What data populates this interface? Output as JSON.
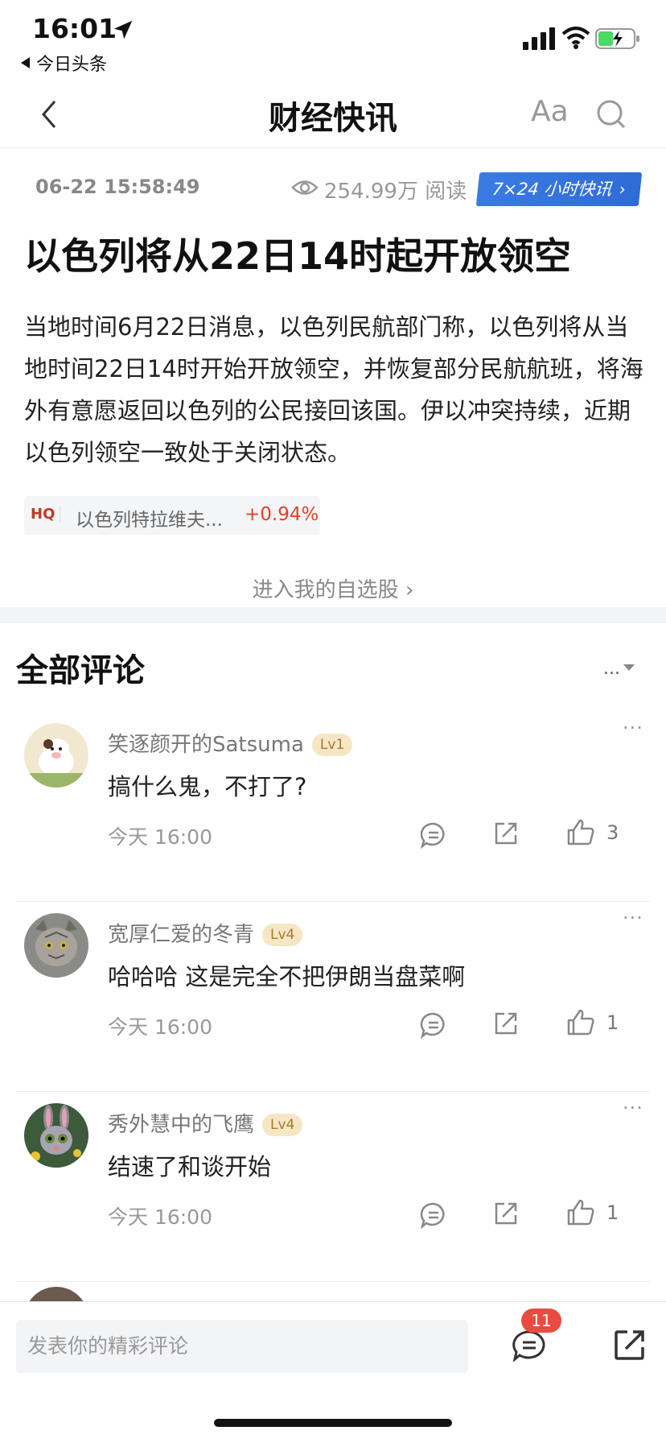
{
  "status_bar": {
    "time": "16:01",
    "back_app_label": "今日头条"
  },
  "nav": {
    "title": "财经快讯",
    "font_label": "Aa"
  },
  "article": {
    "datetime": "06-22 15:58:49",
    "reads": "254.99万 阅读",
    "badge": "7×24 小时快讯",
    "headline": "以色列将从22日14时起开放领空",
    "body": "当地时间6月22日消息，以色列民航部门称，以色列将从当地时间22日14时开始开放领空，并恢复部分民航航班，将海外有意愿返回以色列的公民接回该国。伊以冲突持续，近期以色列领空一致处于关闭状态。",
    "stock": {
      "tag": "HQ",
      "name": "以色列特拉维夫...",
      "change": "+0.94%"
    },
    "watchlist_link": "进入我的自选股"
  },
  "comments_section": {
    "title": "全部评论",
    "sort_label": "..."
  },
  "comments": [
    {
      "user": "笑逐颜开的Satsuma",
      "level": "Lv1",
      "text": "搞什么鬼，不打了?",
      "time": "今天 16:00",
      "likes": "3"
    },
    {
      "user": "宽厚仁爱的冬青",
      "level": "Lv4",
      "text": "哈哈哈 这是完全不把伊朗当盘菜啊",
      "time": "今天 16:00",
      "likes": "1"
    },
    {
      "user": "秀外慧中的飞鹰",
      "level": "Lv4",
      "text": "结速了和谈开始",
      "time": "今天 16:00",
      "likes": "1"
    }
  ],
  "bottom_bar": {
    "input_placeholder": "发表你的精彩评论",
    "comment_count": "11"
  },
  "colors": {
    "accent_blue": "#2f6bd6",
    "up_red": "#e5402b",
    "badge_red": "#ea4a3f",
    "level_bg": "#f6e6c4"
  }
}
